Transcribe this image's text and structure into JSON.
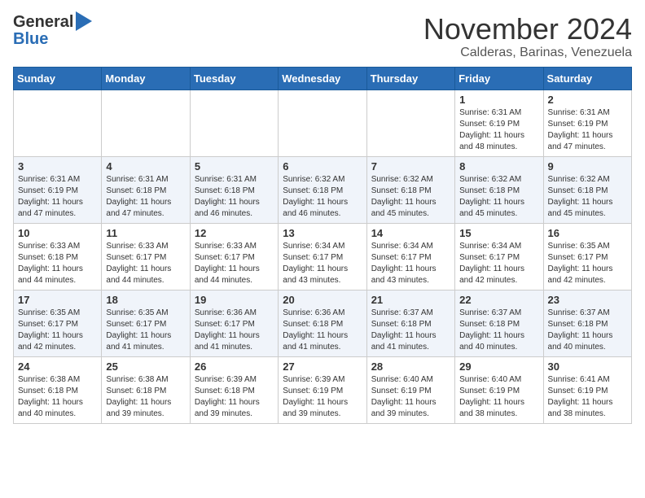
{
  "header": {
    "logo_general": "General",
    "logo_blue": "Blue",
    "month": "November 2024",
    "location": "Calderas, Barinas, Venezuela"
  },
  "days_of_week": [
    "Sunday",
    "Monday",
    "Tuesday",
    "Wednesday",
    "Thursday",
    "Friday",
    "Saturday"
  ],
  "weeks": [
    [
      {
        "day": "",
        "info": ""
      },
      {
        "day": "",
        "info": ""
      },
      {
        "day": "",
        "info": ""
      },
      {
        "day": "",
        "info": ""
      },
      {
        "day": "",
        "info": ""
      },
      {
        "day": "1",
        "info": "Sunrise: 6:31 AM\nSunset: 6:19 PM\nDaylight: 11 hours\nand 48 minutes."
      },
      {
        "day": "2",
        "info": "Sunrise: 6:31 AM\nSunset: 6:19 PM\nDaylight: 11 hours\nand 47 minutes."
      }
    ],
    [
      {
        "day": "3",
        "info": "Sunrise: 6:31 AM\nSunset: 6:19 PM\nDaylight: 11 hours\nand 47 minutes."
      },
      {
        "day": "4",
        "info": "Sunrise: 6:31 AM\nSunset: 6:18 PM\nDaylight: 11 hours\nand 47 minutes."
      },
      {
        "day": "5",
        "info": "Sunrise: 6:31 AM\nSunset: 6:18 PM\nDaylight: 11 hours\nand 46 minutes."
      },
      {
        "day": "6",
        "info": "Sunrise: 6:32 AM\nSunset: 6:18 PM\nDaylight: 11 hours\nand 46 minutes."
      },
      {
        "day": "7",
        "info": "Sunrise: 6:32 AM\nSunset: 6:18 PM\nDaylight: 11 hours\nand 45 minutes."
      },
      {
        "day": "8",
        "info": "Sunrise: 6:32 AM\nSunset: 6:18 PM\nDaylight: 11 hours\nand 45 minutes."
      },
      {
        "day": "9",
        "info": "Sunrise: 6:32 AM\nSunset: 6:18 PM\nDaylight: 11 hours\nand 45 minutes."
      }
    ],
    [
      {
        "day": "10",
        "info": "Sunrise: 6:33 AM\nSunset: 6:18 PM\nDaylight: 11 hours\nand 44 minutes."
      },
      {
        "day": "11",
        "info": "Sunrise: 6:33 AM\nSunset: 6:17 PM\nDaylight: 11 hours\nand 44 minutes."
      },
      {
        "day": "12",
        "info": "Sunrise: 6:33 AM\nSunset: 6:17 PM\nDaylight: 11 hours\nand 44 minutes."
      },
      {
        "day": "13",
        "info": "Sunrise: 6:34 AM\nSunset: 6:17 PM\nDaylight: 11 hours\nand 43 minutes."
      },
      {
        "day": "14",
        "info": "Sunrise: 6:34 AM\nSunset: 6:17 PM\nDaylight: 11 hours\nand 43 minutes."
      },
      {
        "day": "15",
        "info": "Sunrise: 6:34 AM\nSunset: 6:17 PM\nDaylight: 11 hours\nand 42 minutes."
      },
      {
        "day": "16",
        "info": "Sunrise: 6:35 AM\nSunset: 6:17 PM\nDaylight: 11 hours\nand 42 minutes."
      }
    ],
    [
      {
        "day": "17",
        "info": "Sunrise: 6:35 AM\nSunset: 6:17 PM\nDaylight: 11 hours\nand 42 minutes."
      },
      {
        "day": "18",
        "info": "Sunrise: 6:35 AM\nSunset: 6:17 PM\nDaylight: 11 hours\nand 41 minutes."
      },
      {
        "day": "19",
        "info": "Sunrise: 6:36 AM\nSunset: 6:17 PM\nDaylight: 11 hours\nand 41 minutes."
      },
      {
        "day": "20",
        "info": "Sunrise: 6:36 AM\nSunset: 6:18 PM\nDaylight: 11 hours\nand 41 minutes."
      },
      {
        "day": "21",
        "info": "Sunrise: 6:37 AM\nSunset: 6:18 PM\nDaylight: 11 hours\nand 41 minutes."
      },
      {
        "day": "22",
        "info": "Sunrise: 6:37 AM\nSunset: 6:18 PM\nDaylight: 11 hours\nand 40 minutes."
      },
      {
        "day": "23",
        "info": "Sunrise: 6:37 AM\nSunset: 6:18 PM\nDaylight: 11 hours\nand 40 minutes."
      }
    ],
    [
      {
        "day": "24",
        "info": "Sunrise: 6:38 AM\nSunset: 6:18 PM\nDaylight: 11 hours\nand 40 minutes."
      },
      {
        "day": "25",
        "info": "Sunrise: 6:38 AM\nSunset: 6:18 PM\nDaylight: 11 hours\nand 39 minutes."
      },
      {
        "day": "26",
        "info": "Sunrise: 6:39 AM\nSunset: 6:18 PM\nDaylight: 11 hours\nand 39 minutes."
      },
      {
        "day": "27",
        "info": "Sunrise: 6:39 AM\nSunset: 6:19 PM\nDaylight: 11 hours\nand 39 minutes."
      },
      {
        "day": "28",
        "info": "Sunrise: 6:40 AM\nSunset: 6:19 PM\nDaylight: 11 hours\nand 39 minutes."
      },
      {
        "day": "29",
        "info": "Sunrise: 6:40 AM\nSunset: 6:19 PM\nDaylight: 11 hours\nand 38 minutes."
      },
      {
        "day": "30",
        "info": "Sunrise: 6:41 AM\nSunset: 6:19 PM\nDaylight: 11 hours\nand 38 minutes."
      }
    ]
  ]
}
